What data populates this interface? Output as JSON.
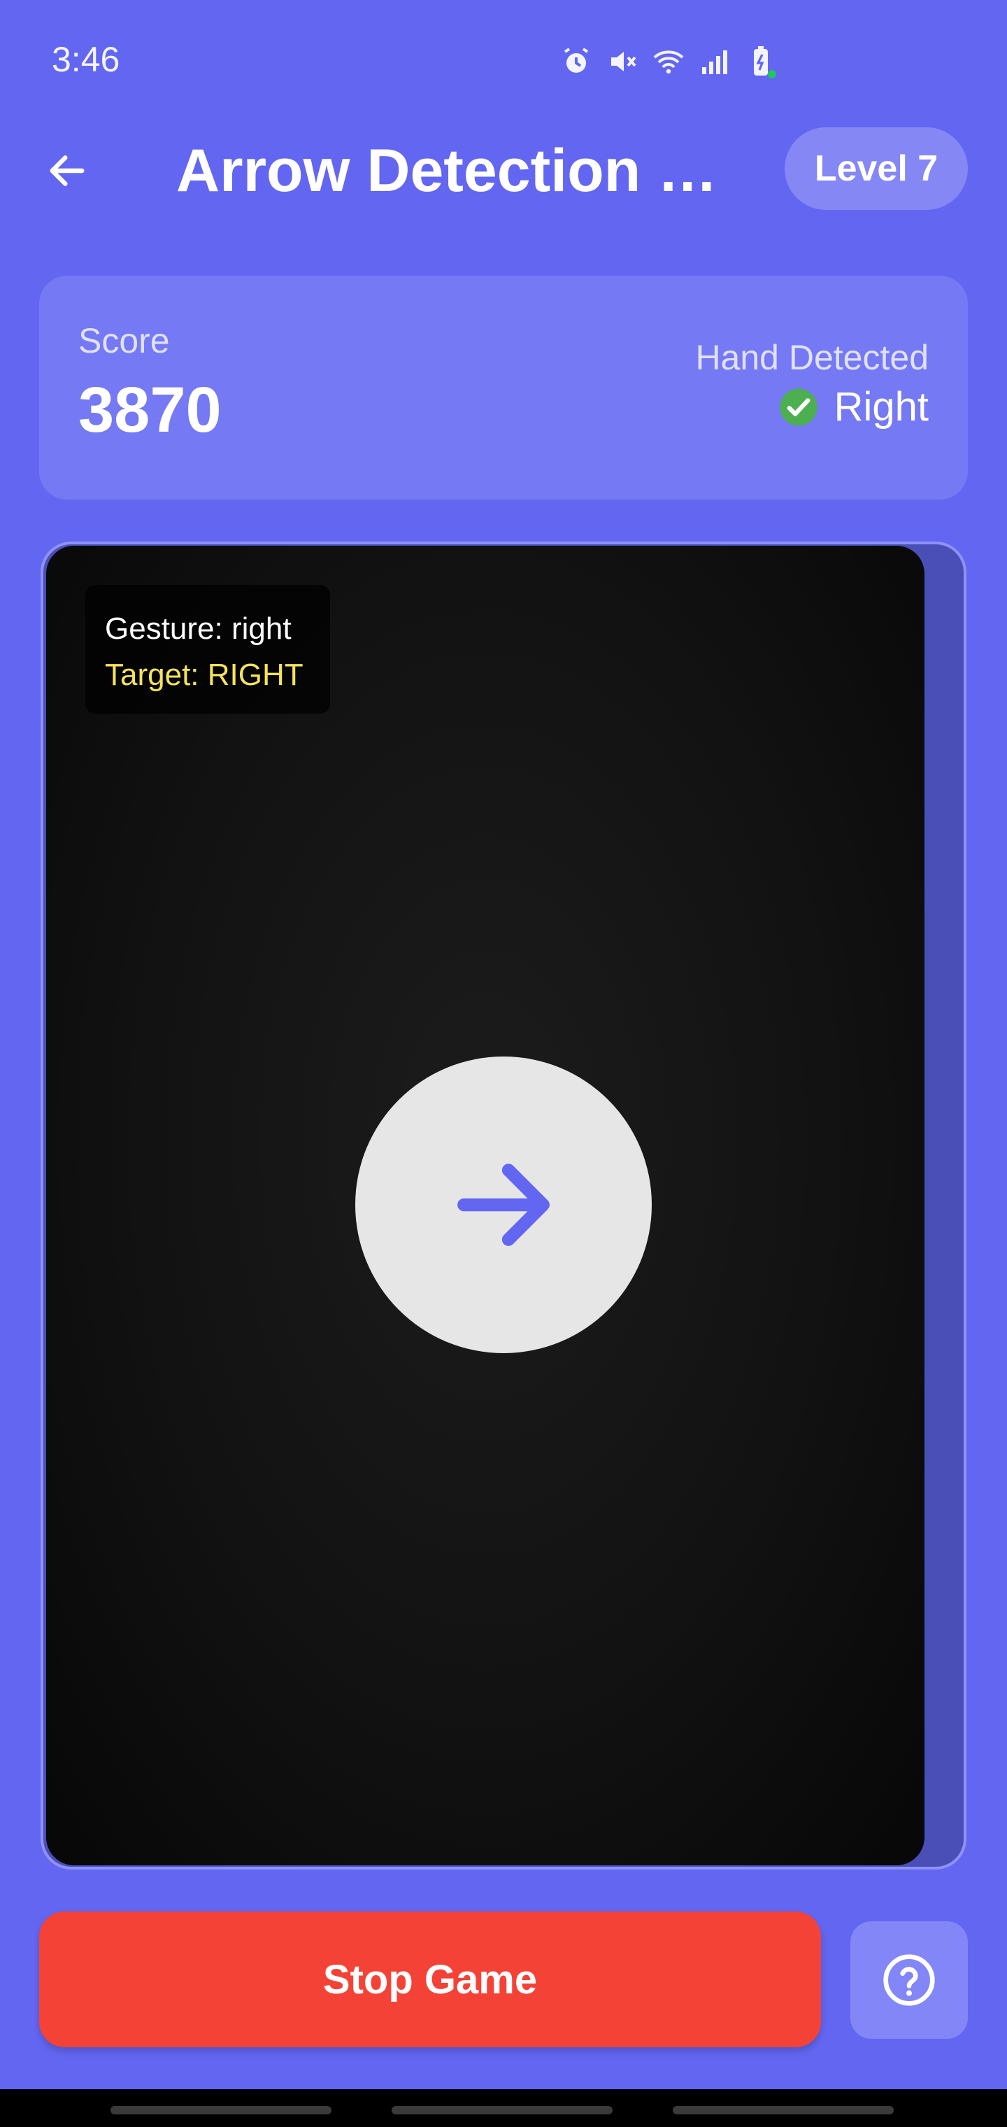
{
  "status_bar": {
    "time": "3:46",
    "icons": [
      "alarm-icon",
      "mute-icon",
      "wifi-icon",
      "signal-icon",
      "battery-charging-icon"
    ]
  },
  "header": {
    "title": "Arrow Detection Ga…",
    "level_label": "Level 7"
  },
  "score_card": {
    "score_label": "Score",
    "score_value": "3870",
    "hand_label": "Hand Detected",
    "hand_value": "Right"
  },
  "camera": {
    "gesture_text": "Gesture: right",
    "target_text": "Target: RIGHT",
    "arrow_direction": "right"
  },
  "actions": {
    "stop_label": "Stop Game",
    "help_icon": "help-circle-icon"
  },
  "colors": {
    "background": "#6366f1",
    "card": "#7579f3",
    "stop_button": "#f44336",
    "target_text": "#f5e35a",
    "check": "#4caf50",
    "arrow": "#6366f1"
  }
}
